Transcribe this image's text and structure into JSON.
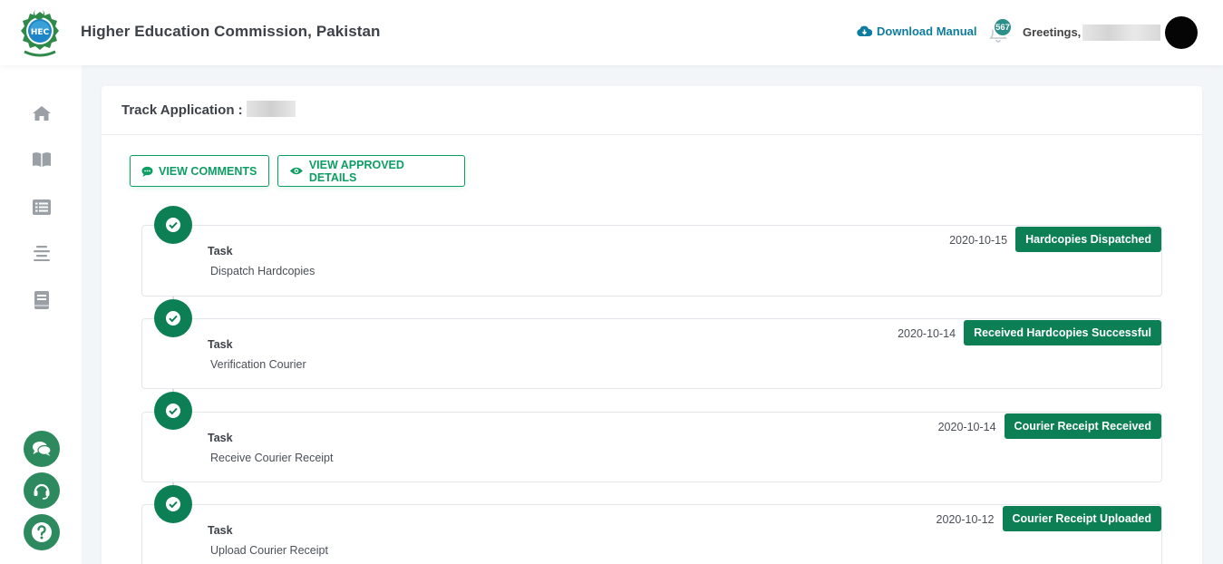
{
  "header": {
    "title": "Higher Education Commission, Pakistan",
    "download_label": "Download Manual",
    "notification_count": "567",
    "greeting": "Greetings,",
    "logo_label": "HEC"
  },
  "sidebar": {
    "items": [
      {
        "icon": "home-icon"
      },
      {
        "icon": "book-open-icon"
      },
      {
        "icon": "list-icon"
      },
      {
        "icon": "align-center-icon"
      },
      {
        "icon": "book-icon"
      }
    ],
    "floating": [
      {
        "icon": "chat-icon"
      },
      {
        "icon": "headset-icon"
      },
      {
        "icon": "help-icon"
      }
    ]
  },
  "card": {
    "title": "Track Application :",
    "view_comments_label": "VIEW COMMENTS",
    "view_approved_label": "VIEW APPROVED DETAILS"
  },
  "timeline": [
    {
      "task_label": "Task",
      "task": "Dispatch Hardcopies",
      "date": "2020-10-15",
      "status": "Hardcopies Dispatched"
    },
    {
      "task_label": "Task",
      "task": "Verification Courier",
      "date": "2020-10-14",
      "status": "Received Hardcopies Successful"
    },
    {
      "task_label": "Task",
      "task": "Receive Courier Receipt",
      "date": "2020-10-14",
      "status": "Courier Receipt Received"
    },
    {
      "task_label": "Task",
      "task": "Upload Courier Receipt",
      "date": "2020-10-12",
      "status": "Courier Receipt Uploaded"
    }
  ],
  "colors": {
    "primary_green": "#0d7f55",
    "outline_green": "#0d9e63",
    "link_teal": "#0e7c9e",
    "badge_teal": "#2d8f8a"
  }
}
